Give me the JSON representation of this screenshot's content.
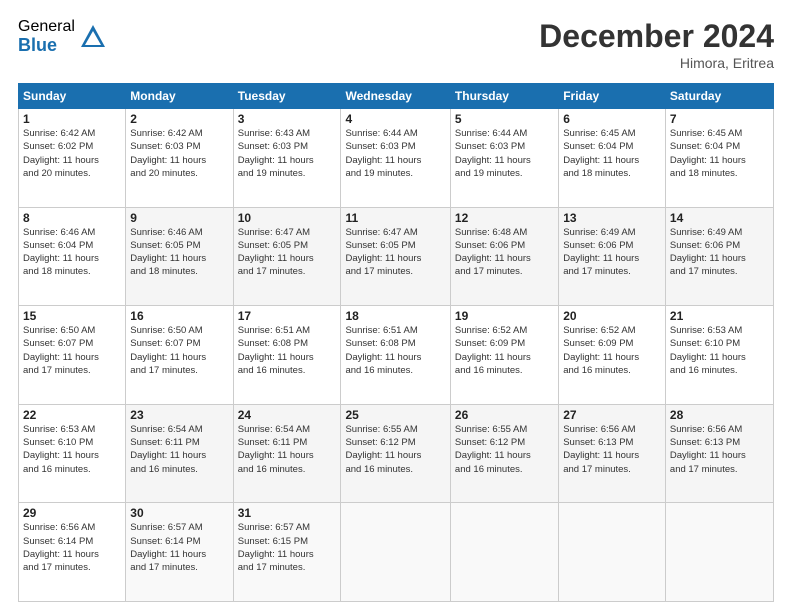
{
  "header": {
    "logo_general": "General",
    "logo_blue": "Blue",
    "month_title": "December 2024",
    "location": "Himora, Eritrea"
  },
  "days_of_week": [
    "Sunday",
    "Monday",
    "Tuesday",
    "Wednesday",
    "Thursday",
    "Friday",
    "Saturday"
  ],
  "weeks": [
    [
      {
        "day": "1",
        "info": "Sunrise: 6:42 AM\nSunset: 6:02 PM\nDaylight: 11 hours\nand 20 minutes."
      },
      {
        "day": "2",
        "info": "Sunrise: 6:42 AM\nSunset: 6:03 PM\nDaylight: 11 hours\nand 20 minutes."
      },
      {
        "day": "3",
        "info": "Sunrise: 6:43 AM\nSunset: 6:03 PM\nDaylight: 11 hours\nand 19 minutes."
      },
      {
        "day": "4",
        "info": "Sunrise: 6:44 AM\nSunset: 6:03 PM\nDaylight: 11 hours\nand 19 minutes."
      },
      {
        "day": "5",
        "info": "Sunrise: 6:44 AM\nSunset: 6:03 PM\nDaylight: 11 hours\nand 19 minutes."
      },
      {
        "day": "6",
        "info": "Sunrise: 6:45 AM\nSunset: 6:04 PM\nDaylight: 11 hours\nand 18 minutes."
      },
      {
        "day": "7",
        "info": "Sunrise: 6:45 AM\nSunset: 6:04 PM\nDaylight: 11 hours\nand 18 minutes."
      }
    ],
    [
      {
        "day": "8",
        "info": "Sunrise: 6:46 AM\nSunset: 6:04 PM\nDaylight: 11 hours\nand 18 minutes."
      },
      {
        "day": "9",
        "info": "Sunrise: 6:46 AM\nSunset: 6:05 PM\nDaylight: 11 hours\nand 18 minutes."
      },
      {
        "day": "10",
        "info": "Sunrise: 6:47 AM\nSunset: 6:05 PM\nDaylight: 11 hours\nand 17 minutes."
      },
      {
        "day": "11",
        "info": "Sunrise: 6:47 AM\nSunset: 6:05 PM\nDaylight: 11 hours\nand 17 minutes."
      },
      {
        "day": "12",
        "info": "Sunrise: 6:48 AM\nSunset: 6:06 PM\nDaylight: 11 hours\nand 17 minutes."
      },
      {
        "day": "13",
        "info": "Sunrise: 6:49 AM\nSunset: 6:06 PM\nDaylight: 11 hours\nand 17 minutes."
      },
      {
        "day": "14",
        "info": "Sunrise: 6:49 AM\nSunset: 6:06 PM\nDaylight: 11 hours\nand 17 minutes."
      }
    ],
    [
      {
        "day": "15",
        "info": "Sunrise: 6:50 AM\nSunset: 6:07 PM\nDaylight: 11 hours\nand 17 minutes."
      },
      {
        "day": "16",
        "info": "Sunrise: 6:50 AM\nSunset: 6:07 PM\nDaylight: 11 hours\nand 17 minutes."
      },
      {
        "day": "17",
        "info": "Sunrise: 6:51 AM\nSunset: 6:08 PM\nDaylight: 11 hours\nand 16 minutes."
      },
      {
        "day": "18",
        "info": "Sunrise: 6:51 AM\nSunset: 6:08 PM\nDaylight: 11 hours\nand 16 minutes."
      },
      {
        "day": "19",
        "info": "Sunrise: 6:52 AM\nSunset: 6:09 PM\nDaylight: 11 hours\nand 16 minutes."
      },
      {
        "day": "20",
        "info": "Sunrise: 6:52 AM\nSunset: 6:09 PM\nDaylight: 11 hours\nand 16 minutes."
      },
      {
        "day": "21",
        "info": "Sunrise: 6:53 AM\nSunset: 6:10 PM\nDaylight: 11 hours\nand 16 minutes."
      }
    ],
    [
      {
        "day": "22",
        "info": "Sunrise: 6:53 AM\nSunset: 6:10 PM\nDaylight: 11 hours\nand 16 minutes."
      },
      {
        "day": "23",
        "info": "Sunrise: 6:54 AM\nSunset: 6:11 PM\nDaylight: 11 hours\nand 16 minutes."
      },
      {
        "day": "24",
        "info": "Sunrise: 6:54 AM\nSunset: 6:11 PM\nDaylight: 11 hours\nand 16 minutes."
      },
      {
        "day": "25",
        "info": "Sunrise: 6:55 AM\nSunset: 6:12 PM\nDaylight: 11 hours\nand 16 minutes."
      },
      {
        "day": "26",
        "info": "Sunrise: 6:55 AM\nSunset: 6:12 PM\nDaylight: 11 hours\nand 16 minutes."
      },
      {
        "day": "27",
        "info": "Sunrise: 6:56 AM\nSunset: 6:13 PM\nDaylight: 11 hours\nand 17 minutes."
      },
      {
        "day": "28",
        "info": "Sunrise: 6:56 AM\nSunset: 6:13 PM\nDaylight: 11 hours\nand 17 minutes."
      }
    ],
    [
      {
        "day": "29",
        "info": "Sunrise: 6:56 AM\nSunset: 6:14 PM\nDaylight: 11 hours\nand 17 minutes."
      },
      {
        "day": "30",
        "info": "Sunrise: 6:57 AM\nSunset: 6:14 PM\nDaylight: 11 hours\nand 17 minutes."
      },
      {
        "day": "31",
        "info": "Sunrise: 6:57 AM\nSunset: 6:15 PM\nDaylight: 11 hours\nand 17 minutes."
      },
      {
        "day": "",
        "info": ""
      },
      {
        "day": "",
        "info": ""
      },
      {
        "day": "",
        "info": ""
      },
      {
        "day": "",
        "info": ""
      }
    ]
  ]
}
